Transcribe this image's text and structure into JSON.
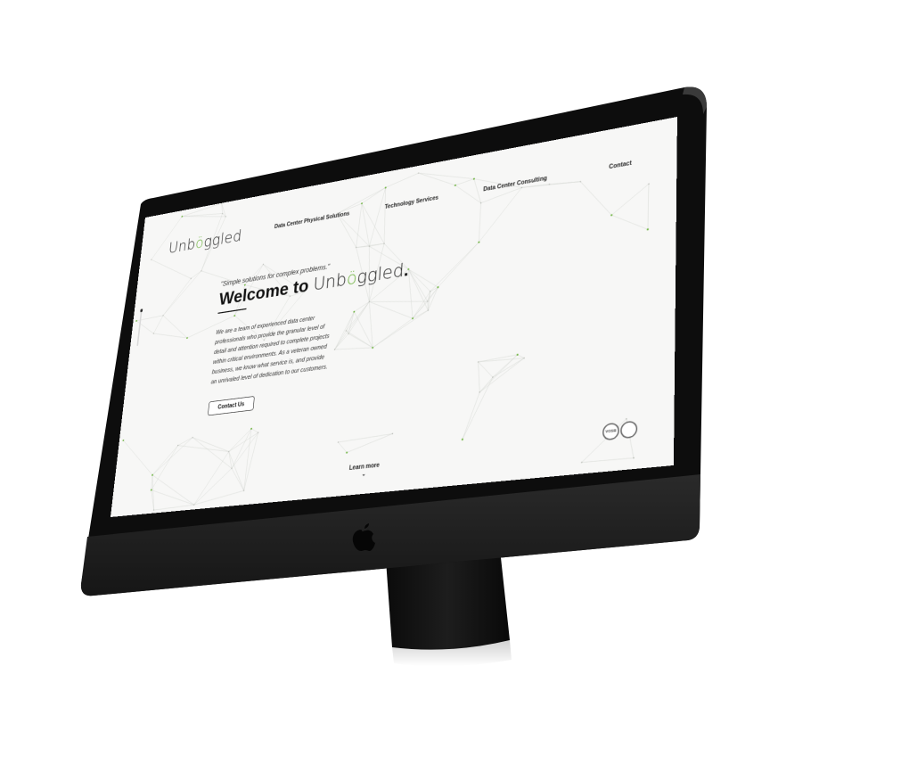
{
  "site": {
    "logo": {
      "before": "Unb",
      "accent": "ö",
      "after": "ggled"
    },
    "nav": [
      {
        "label": "Data Center Physical Solutions"
      },
      {
        "label": "Technology Services"
      },
      {
        "label": "Data Center Consulting"
      },
      {
        "label": "Contact"
      }
    ],
    "hero": {
      "tagline": "\"Simple solutions for complex problems.\"",
      "headline_prefix": "Welcome to ",
      "headline_brand": {
        "before": "Unb",
        "accent": "ö",
        "after": "ggled"
      },
      "headline_suffix": ".",
      "intro": "We are a team of experienced data center professionals who provide the granular level of detail and attention required to complete projects within critical environments. As a veteran owned business, we know what service is, and provide an unrivaled level of dedication to our customers.",
      "cta_label": "Contact Us"
    },
    "learn_more": {
      "label": "Learn more",
      "chevron": "⌄"
    },
    "badges": [
      {
        "label": "VOSB"
      },
      {
        "label": ""
      }
    ]
  },
  "colors": {
    "accent": "#6db33f",
    "screen_bg": "#f7f7f6",
    "bezel": "#0d0d0d",
    "chin": "#232323",
    "text": "#111111"
  },
  "device": {
    "logo_icon": "apple-logo-icon"
  }
}
